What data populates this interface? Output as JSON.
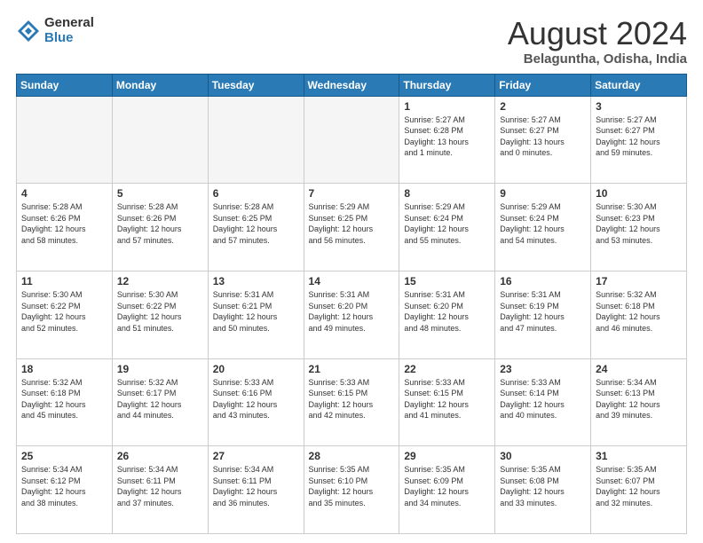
{
  "logo": {
    "general": "General",
    "blue": "Blue"
  },
  "header": {
    "month": "August 2024",
    "location": "Belaguntha, Odisha, India"
  },
  "weekdays": [
    "Sunday",
    "Monday",
    "Tuesday",
    "Wednesday",
    "Thursday",
    "Friday",
    "Saturday"
  ],
  "weeks": [
    [
      {
        "day": "",
        "info": ""
      },
      {
        "day": "",
        "info": ""
      },
      {
        "day": "",
        "info": ""
      },
      {
        "day": "",
        "info": ""
      },
      {
        "day": "1",
        "info": "Sunrise: 5:27 AM\nSunset: 6:28 PM\nDaylight: 13 hours\nand 1 minute."
      },
      {
        "day": "2",
        "info": "Sunrise: 5:27 AM\nSunset: 6:27 PM\nDaylight: 13 hours\nand 0 minutes."
      },
      {
        "day": "3",
        "info": "Sunrise: 5:27 AM\nSunset: 6:27 PM\nDaylight: 12 hours\nand 59 minutes."
      }
    ],
    [
      {
        "day": "4",
        "info": "Sunrise: 5:28 AM\nSunset: 6:26 PM\nDaylight: 12 hours\nand 58 minutes."
      },
      {
        "day": "5",
        "info": "Sunrise: 5:28 AM\nSunset: 6:26 PM\nDaylight: 12 hours\nand 57 minutes."
      },
      {
        "day": "6",
        "info": "Sunrise: 5:28 AM\nSunset: 6:25 PM\nDaylight: 12 hours\nand 57 minutes."
      },
      {
        "day": "7",
        "info": "Sunrise: 5:29 AM\nSunset: 6:25 PM\nDaylight: 12 hours\nand 56 minutes."
      },
      {
        "day": "8",
        "info": "Sunrise: 5:29 AM\nSunset: 6:24 PM\nDaylight: 12 hours\nand 55 minutes."
      },
      {
        "day": "9",
        "info": "Sunrise: 5:29 AM\nSunset: 6:24 PM\nDaylight: 12 hours\nand 54 minutes."
      },
      {
        "day": "10",
        "info": "Sunrise: 5:30 AM\nSunset: 6:23 PM\nDaylight: 12 hours\nand 53 minutes."
      }
    ],
    [
      {
        "day": "11",
        "info": "Sunrise: 5:30 AM\nSunset: 6:22 PM\nDaylight: 12 hours\nand 52 minutes."
      },
      {
        "day": "12",
        "info": "Sunrise: 5:30 AM\nSunset: 6:22 PM\nDaylight: 12 hours\nand 51 minutes."
      },
      {
        "day": "13",
        "info": "Sunrise: 5:31 AM\nSunset: 6:21 PM\nDaylight: 12 hours\nand 50 minutes."
      },
      {
        "day": "14",
        "info": "Sunrise: 5:31 AM\nSunset: 6:20 PM\nDaylight: 12 hours\nand 49 minutes."
      },
      {
        "day": "15",
        "info": "Sunrise: 5:31 AM\nSunset: 6:20 PM\nDaylight: 12 hours\nand 48 minutes."
      },
      {
        "day": "16",
        "info": "Sunrise: 5:31 AM\nSunset: 6:19 PM\nDaylight: 12 hours\nand 47 minutes."
      },
      {
        "day": "17",
        "info": "Sunrise: 5:32 AM\nSunset: 6:18 PM\nDaylight: 12 hours\nand 46 minutes."
      }
    ],
    [
      {
        "day": "18",
        "info": "Sunrise: 5:32 AM\nSunset: 6:18 PM\nDaylight: 12 hours\nand 45 minutes."
      },
      {
        "day": "19",
        "info": "Sunrise: 5:32 AM\nSunset: 6:17 PM\nDaylight: 12 hours\nand 44 minutes."
      },
      {
        "day": "20",
        "info": "Sunrise: 5:33 AM\nSunset: 6:16 PM\nDaylight: 12 hours\nand 43 minutes."
      },
      {
        "day": "21",
        "info": "Sunrise: 5:33 AM\nSunset: 6:15 PM\nDaylight: 12 hours\nand 42 minutes."
      },
      {
        "day": "22",
        "info": "Sunrise: 5:33 AM\nSunset: 6:15 PM\nDaylight: 12 hours\nand 41 minutes."
      },
      {
        "day": "23",
        "info": "Sunrise: 5:33 AM\nSunset: 6:14 PM\nDaylight: 12 hours\nand 40 minutes."
      },
      {
        "day": "24",
        "info": "Sunrise: 5:34 AM\nSunset: 6:13 PM\nDaylight: 12 hours\nand 39 minutes."
      }
    ],
    [
      {
        "day": "25",
        "info": "Sunrise: 5:34 AM\nSunset: 6:12 PM\nDaylight: 12 hours\nand 38 minutes."
      },
      {
        "day": "26",
        "info": "Sunrise: 5:34 AM\nSunset: 6:11 PM\nDaylight: 12 hours\nand 37 minutes."
      },
      {
        "day": "27",
        "info": "Sunrise: 5:34 AM\nSunset: 6:11 PM\nDaylight: 12 hours\nand 36 minutes."
      },
      {
        "day": "28",
        "info": "Sunrise: 5:35 AM\nSunset: 6:10 PM\nDaylight: 12 hours\nand 35 minutes."
      },
      {
        "day": "29",
        "info": "Sunrise: 5:35 AM\nSunset: 6:09 PM\nDaylight: 12 hours\nand 34 minutes."
      },
      {
        "day": "30",
        "info": "Sunrise: 5:35 AM\nSunset: 6:08 PM\nDaylight: 12 hours\nand 33 minutes."
      },
      {
        "day": "31",
        "info": "Sunrise: 5:35 AM\nSunset: 6:07 PM\nDaylight: 12 hours\nand 32 minutes."
      }
    ]
  ]
}
